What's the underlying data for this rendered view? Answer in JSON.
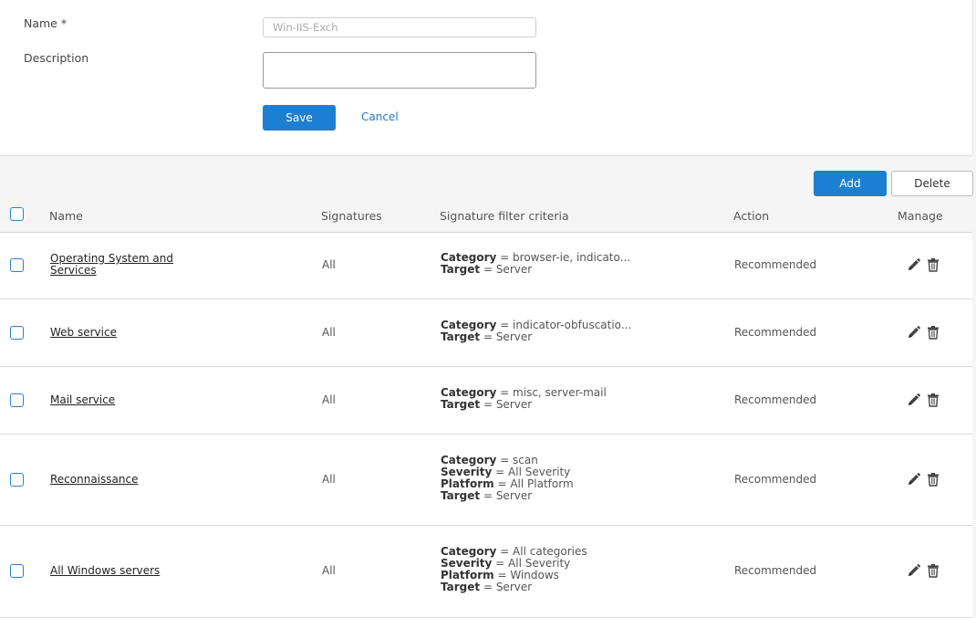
{
  "form": {
    "name_label": "Name *",
    "name_value": "Win-IIS-Exch",
    "description_label": "Description",
    "description_value": "",
    "save_label": "Save",
    "cancel_label": "Cancel"
  },
  "toolbar": {
    "add_label": "Add",
    "delete_label": "Delete"
  },
  "table": {
    "columns": {
      "name": "Name",
      "signatures": "Signatures",
      "criteria": "Signature filter criteria",
      "action": "Action",
      "manage": "Manage"
    },
    "rows": [
      {
        "name": "Operating System and Services",
        "signatures": "All",
        "criteria": [
          {
            "key": "Category",
            "value": "browser-ie, indicato..."
          },
          {
            "key": "Target",
            "value": "Server"
          }
        ],
        "action": "Recommended"
      },
      {
        "name": "Web service",
        "signatures": "All",
        "criteria": [
          {
            "key": "Category",
            "value": "indicator-obfuscatio..."
          },
          {
            "key": "Target",
            "value": "Server"
          }
        ],
        "action": "Recommended"
      },
      {
        "name": "Mail service",
        "signatures": "All",
        "criteria": [
          {
            "key": "Category",
            "value": "misc, server-mail"
          },
          {
            "key": "Target",
            "value": "Server"
          }
        ],
        "action": "Recommended"
      },
      {
        "name": "Reconnaissance",
        "signatures": "All",
        "criteria": [
          {
            "key": "Category",
            "value": "scan"
          },
          {
            "key": "Severity",
            "value": "All Severity"
          },
          {
            "key": "Platform",
            "value": "All Platform"
          },
          {
            "key": "Target",
            "value": "Server"
          }
        ],
        "action": "Recommended"
      },
      {
        "name": "All Windows servers",
        "signatures": "All",
        "criteria": [
          {
            "key": "Category",
            "value": "All categories"
          },
          {
            "key": "Severity",
            "value": "All Severity"
          },
          {
            "key": "Platform",
            "value": "Windows"
          },
          {
            "key": "Target",
            "value": "Server"
          }
        ],
        "action": "Recommended"
      }
    ]
  },
  "colors": {
    "primary": "#1d7fd1",
    "link": "#2378c4",
    "checkbox": "#2a7fd0"
  }
}
